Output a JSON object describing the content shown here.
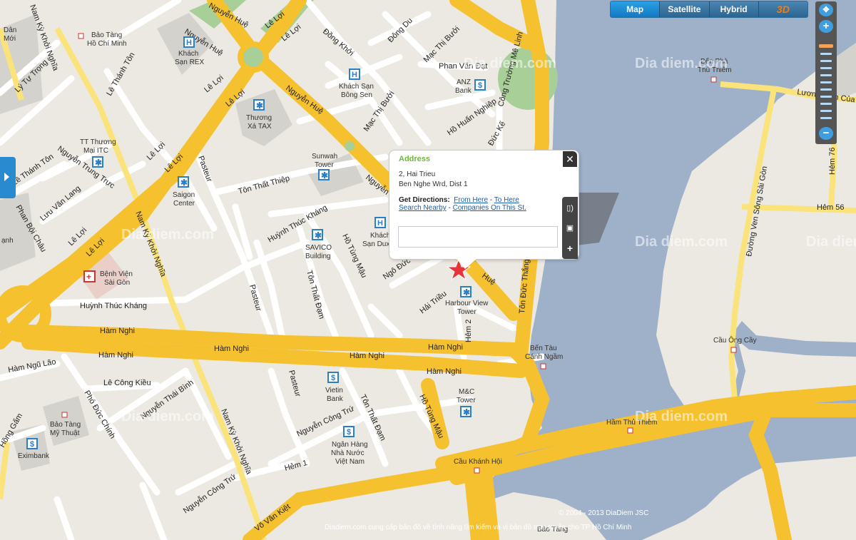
{
  "map_type_buttons": [
    {
      "label": "Map",
      "active": true
    },
    {
      "label": "Satellite",
      "active": false
    },
    {
      "label": "Hybrid",
      "active": false
    }
  ],
  "map_3d_label": "3D",
  "zoom": {
    "in_label": "+",
    "out_label": "−",
    "level_fraction": 0.18
  },
  "popup": {
    "title": "Address",
    "address_line1": "2, Hai Trieu",
    "address_line2": "Ben Nghe Wrd, Dist 1",
    "directions_label": "Get Directions:",
    "from_here": "From Here",
    "to_here": "To Here",
    "search_nearby": "Search Nearby",
    "companies": "Companies On This St.",
    "search_value": "",
    "close_label": "✕",
    "side_icons": [
      "sound-icon",
      "camera-icon",
      "plus-icon"
    ]
  },
  "colors": {
    "water": "#9fb1c9",
    "land": "#ece9e2",
    "major_road": "#f5c12f",
    "minor_road": "#ffffff",
    "park": "#a8cf97",
    "accent": "#2a8ad0"
  },
  "road_labels": {
    "nam_ky_khoi_nghia": "Nam Kỳ Khởi Nghĩa",
    "nguyen_hue": "Nguyễn Huệ",
    "le_loi": "Lê Lợi",
    "ham_nghi": "Hàm Nghi",
    "huynh_thuc_khang": "Huỳnh Thúc Kháng",
    "le_thanh_ton": "Lê Thánh Tôn",
    "ly_tu_trong": "Lý Tự Trọng",
    "dong_khoi": "Đồng Khởi",
    "dong_du": "Đông Du",
    "mac_thi_buoi": "Mạc Thị Bưởi",
    "phan_van_dat": "Phan Văn Đạt",
    "cong_truong_me_linh": "Công Trường Mê Linh",
    "ho_huan_nghiep": "Hồ Huấn Nghiệp",
    "duc_ke": "Đức Kế",
    "ton_duc_thang": "Tôn Đức Thắng",
    "ton_that_thiep": "Tôn Thất Thiệp",
    "pasteur": "Pasteur",
    "nguyen_trung_truc": "Nguyễn Trung Trực",
    "luu_van_lang": "Lưu Văn Lang",
    "phan_boi_chau": "Phan Bội Châu",
    "huynh_thuc_khang2": "Huỳnh Thúc Kháng",
    "ton_that_dam": "Tôn Thất Đạm",
    "ho_tung_mau": "Hồ Tùng Mậu",
    "ngo_duc_ke": "Ngô Đức",
    "hai_trieu": "Hải Triều",
    "hem_2": "Hẻm 2",
    "ham_ngu_lao": "Hàm Ngũ Lão",
    "le_cong_kieu": "Lê Công Kiều",
    "nguyen_thai_binh": "Nguyễn Thái Bình",
    "pho_duc_chinh": "Phó Đức Chính",
    "nguyen_cong_tru": "Nguyễn Công Trứ",
    "hem_1": "Hẻm 1",
    "vo_van_kiet": "Võ Văn Kiệt",
    "ho_tung_mau2": "Hồ Tùng Mậu",
    "ton_that_dam2": "Tôn Thất Đạm",
    "pasteur2": "Pasteur",
    "nam_ky_khoi_nghia2": "Nam Kỳ Khởi Nghĩa",
    "le_thanh_ton2": "Lê Thánh Tôn",
    "luong_dinh_cua": "Lương Định Của",
    "duong_ven_song": "Đường Ven Sông Sài Gòn",
    "hem_76": "Hẻm 76",
    "hem_56": "Hẻm 56",
    "hong_gam": "Hồng Gấm",
    "hem_huy": "Huệ"
  },
  "places": [
    {
      "id": "bao_tang_hcm",
      "lines": [
        "Bảo Tàng",
        "Hồ Chí Minh"
      ]
    },
    {
      "id": "khach_san_rex",
      "lines": [
        "Khách",
        "Sạn REX"
      ]
    },
    {
      "id": "khach_san_bong_sen",
      "lines": [
        "Khách Sạn",
        "Bông Sen"
      ]
    },
    {
      "id": "anz_bank",
      "lines": [
        "ANZ",
        "Bank"
      ]
    },
    {
      "id": "thuong_xa_tax",
      "lines": [
        "Thương",
        "Xá TAX"
      ]
    },
    {
      "id": "tt_thuong_mai",
      "lines": [
        "TT Thương",
        "Mại ITC"
      ]
    },
    {
      "id": "sunwah",
      "lines": [
        "Sunwah",
        "Tower"
      ]
    },
    {
      "id": "saigon_center",
      "lines": [
        "Saigon",
        "Center"
      ]
    },
    {
      "id": "khach_san_dux",
      "lines": [
        "Khách",
        "Sạn Dux"
      ]
    },
    {
      "id": "savico",
      "lines": [
        "SAVICO",
        "Building"
      ]
    },
    {
      "id": "benh_vien",
      "lines": [
        "Bệnh Viện",
        "Sài Gòn"
      ]
    },
    {
      "id": "harbour_view",
      "lines": [
        "Harbour View",
        "Tower"
      ]
    },
    {
      "id": "ben_tau",
      "lines": [
        "Bến Tàu",
        "Cánh Ngầm"
      ]
    },
    {
      "id": "vietin",
      "lines": [
        "Vietin",
        "Bank"
      ]
    },
    {
      "id": "mc_tower",
      "lines": [
        "M&C",
        "Tower"
      ]
    },
    {
      "id": "bao_tang_my_thuat",
      "lines": [
        "Bảo Tàng",
        "Mỹ Thuật"
      ]
    },
    {
      "id": "ngan_hang_nha_nuoc",
      "lines": [
        "Ngân Hàng",
        "Nhà Nước",
        "Việt Nam"
      ]
    },
    {
      "id": "eximbank",
      "lines": [
        "Eximbank"
      ]
    },
    {
      "id": "ham_thu_thiem",
      "lines": [
        "Hầm Thủ Thiêm"
      ]
    },
    {
      "id": "cau_khanh_hoi",
      "lines": [
        "Cầu Khánh Hội"
      ]
    },
    {
      "id": "cau_ong_cay",
      "lines": [
        "Cầu Ông Cầy"
      ]
    },
    {
      "id": "ben_pha",
      "lines": [
        "Bến Phà",
        "Thủ Thiêm"
      ]
    },
    {
      "id": "bao_tang_bottom",
      "lines": [
        "Bảo Tàng"
      ]
    },
    {
      "id": "dan_chu",
      "lines": [
        "Dân",
        "Mới"
      ]
    },
    {
      "id": "anh",
      "lines": [
        "ạnh"
      ]
    }
  ],
  "watermark": "Dia diem.com",
  "copyright": "© 2004 - 2013 DiaDiem JSC",
  "footer_text": "Diadiem.com cung cấp bản đồ về tính năng tìm kiếm và vị bản đồ trực tuyến cho TP Hồ Chí Minh"
}
